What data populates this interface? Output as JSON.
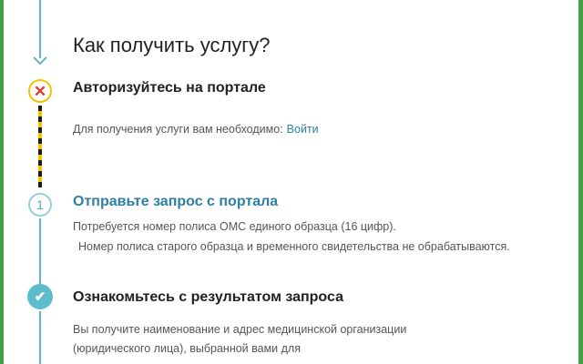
{
  "title": "Как получить услугу?",
  "steps": [
    {
      "status": "error",
      "icon": "close-icon",
      "heading": "Авторизуйтесь на портале",
      "text": "Для получения услуги вам необходимо:",
      "link": "Войти"
    },
    {
      "status": "pending",
      "number": "1",
      "heading": "Отправьте запрос с портала",
      "lines": [
        "Потребуется номер полиса ОМС единого образца (16 цифр).",
        "Номер полиса старого образца и временного  свидетельства не обрабатываются."
      ]
    },
    {
      "status": "done",
      "icon": "check-icon",
      "heading": "Ознакомьтесь с результатом запроса",
      "lines": [
        "Вы получите наименование и адрес медицинской организации",
        "(юридического лица), выбранной вами для",
        ""
      ]
    }
  ],
  "colors": {
    "frame": "#43a047",
    "timeline": "#64b5c6",
    "error": "#e53935",
    "warning_dash": "#f2c400",
    "link": "#2d7fa6",
    "done": "#5dbcca"
  }
}
